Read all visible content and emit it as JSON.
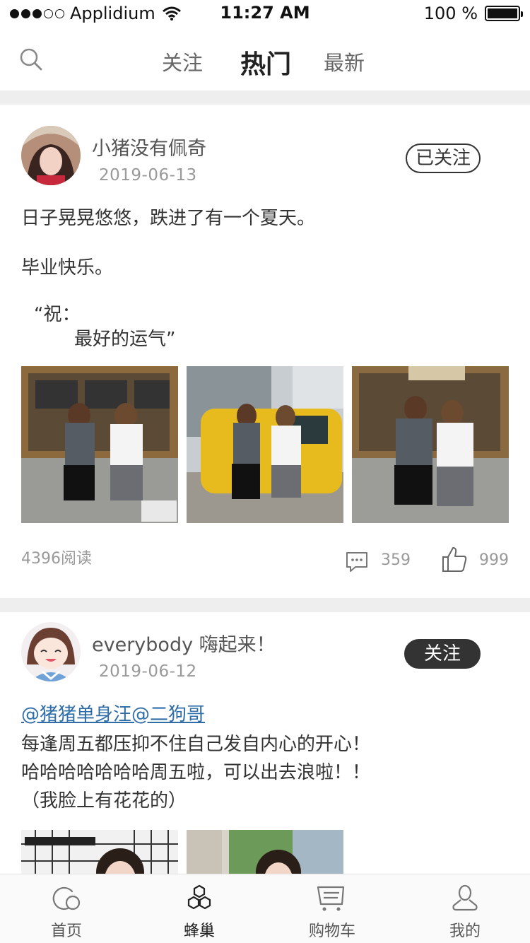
{
  "status_bar": {
    "carrier": "Applidium",
    "time": "11:27 AM",
    "battery": "100 %"
  },
  "nav": {
    "tabs": [
      {
        "label": "关注",
        "active": false
      },
      {
        "label": "热门",
        "active": true
      },
      {
        "label": "最新",
        "active": false
      }
    ]
  },
  "posts": [
    {
      "username": "小猪没有佩奇",
      "date": "2019-06-13",
      "follow_label": "已关注",
      "followed": true,
      "lines": [
        "日子晃晃悠悠，跌进了有一个夏天。",
        "毕业快乐。",
        "“祝：",
        "最好的运气”"
      ],
      "reads": "4396阅读",
      "comments": "359",
      "likes": "999"
    },
    {
      "username": "everybody 嗨起来！",
      "date": "2019-06-12",
      "follow_label": "关注",
      "followed": false,
      "mention": "@猪猪单身汪@二狗哥",
      "lines": [
        "每逢周五都压抑不住自己发自内心的开心！",
        "哈哈哈哈哈哈哈周五啦，可以出去浪啦！！",
        "（我脸上有花花的）"
      ]
    }
  ],
  "tabbar": {
    "items": [
      {
        "label": "首页",
        "icon": "home-icon"
      },
      {
        "label": "蜂巢",
        "icon": "hive-icon"
      },
      {
        "label": "购物车",
        "icon": "cart-icon"
      },
      {
        "label": "我的",
        "icon": "profile-icon"
      }
    ]
  }
}
